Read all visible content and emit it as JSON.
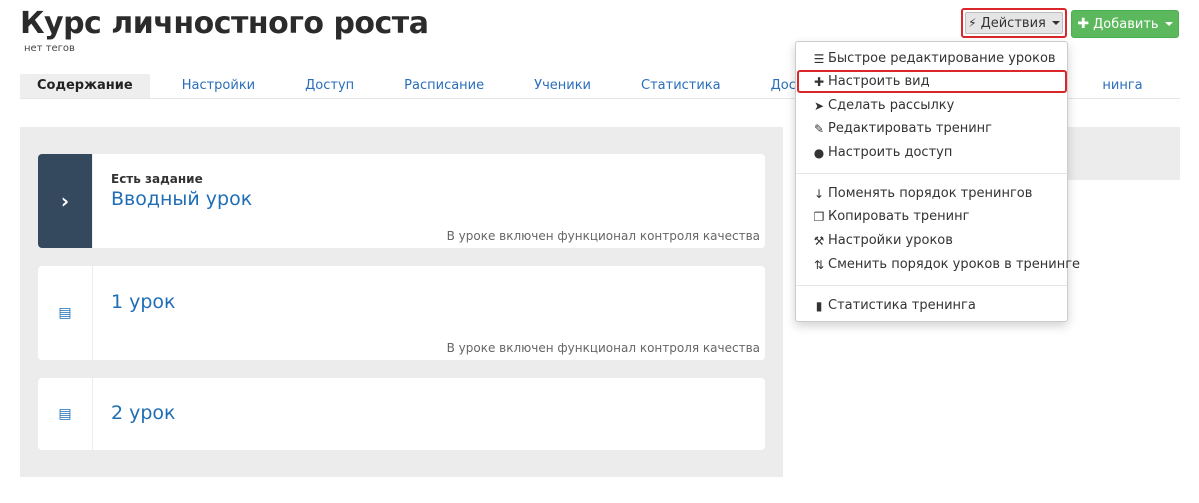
{
  "header": {
    "title": "Курс личностного роста",
    "tags": "нет тегов",
    "actions_label": "Действия",
    "add_label": "Добавить"
  },
  "tabs": [
    {
      "label": "Содержание"
    },
    {
      "label": "Настройки"
    },
    {
      "label": "Доступ"
    },
    {
      "label": "Расписание"
    },
    {
      "label": "Ученики"
    },
    {
      "label": "Статистика"
    },
    {
      "label": "Достижения"
    },
    {
      "label": "нинга"
    }
  ],
  "lessons": [
    {
      "label": "Есть задание",
      "title": "Вводный урок",
      "note": "В уроке включен функционал контроля качества"
    },
    {
      "title": "1 урок",
      "note": "В уроке включен функционал контроля качества"
    },
    {
      "title": "2 урок"
    }
  ],
  "menu": [
    {
      "label": "Быстрое редактирование уроков",
      "icon": "list-icon"
    },
    {
      "label": "Настроить вид",
      "icon": "puzzle-icon"
    },
    {
      "label": "Сделать рассылку",
      "icon": "send-icon"
    },
    {
      "label": "Редактировать тренинг",
      "icon": "edit-icon"
    },
    {
      "label": "Настроить доступ",
      "icon": "user-icon"
    },
    {
      "label": "Поменять порядок тренингов",
      "icon": "sort-icon"
    },
    {
      "label": "Копировать тренинг",
      "icon": "copy-icon"
    },
    {
      "label": "Настройки уроков",
      "icon": "wrench-icon"
    },
    {
      "label": "Сменить порядок уроков в тренинге",
      "icon": "swap-icon"
    },
    {
      "label": "Статистика тренинга",
      "icon": "chart-icon"
    }
  ],
  "colors": {
    "accent_link": "#1f6db5",
    "add_button": "#5cb85c",
    "highlight_border": "#d9272c",
    "lesson_side_dark": "#34495e"
  }
}
